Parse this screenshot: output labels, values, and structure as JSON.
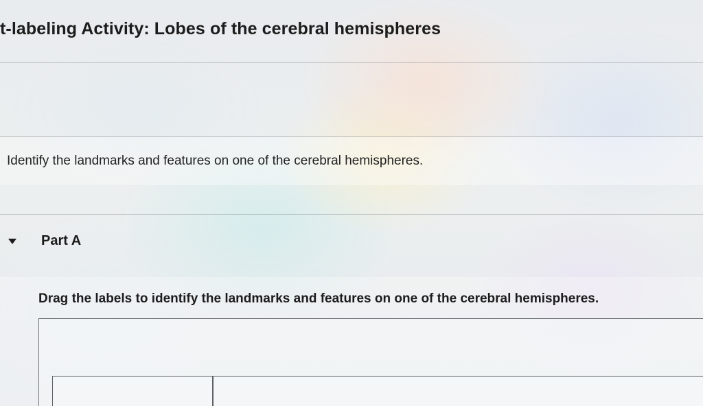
{
  "header": {
    "title": "t-labeling Activity: Lobes of the cerebral hemispheres"
  },
  "intro": {
    "text": "Identify the landmarks and features on one of the cerebral hemispheres."
  },
  "part_a": {
    "label": "Part A",
    "expanded": true,
    "instruction": "Drag the labels to identify the landmarks and features on one of the cerebral hemispheres."
  },
  "icons": {
    "part_toggle": "caret-down-icon"
  },
  "colors": {
    "text": "#1c1c1c",
    "divider": "#8c9196"
  }
}
